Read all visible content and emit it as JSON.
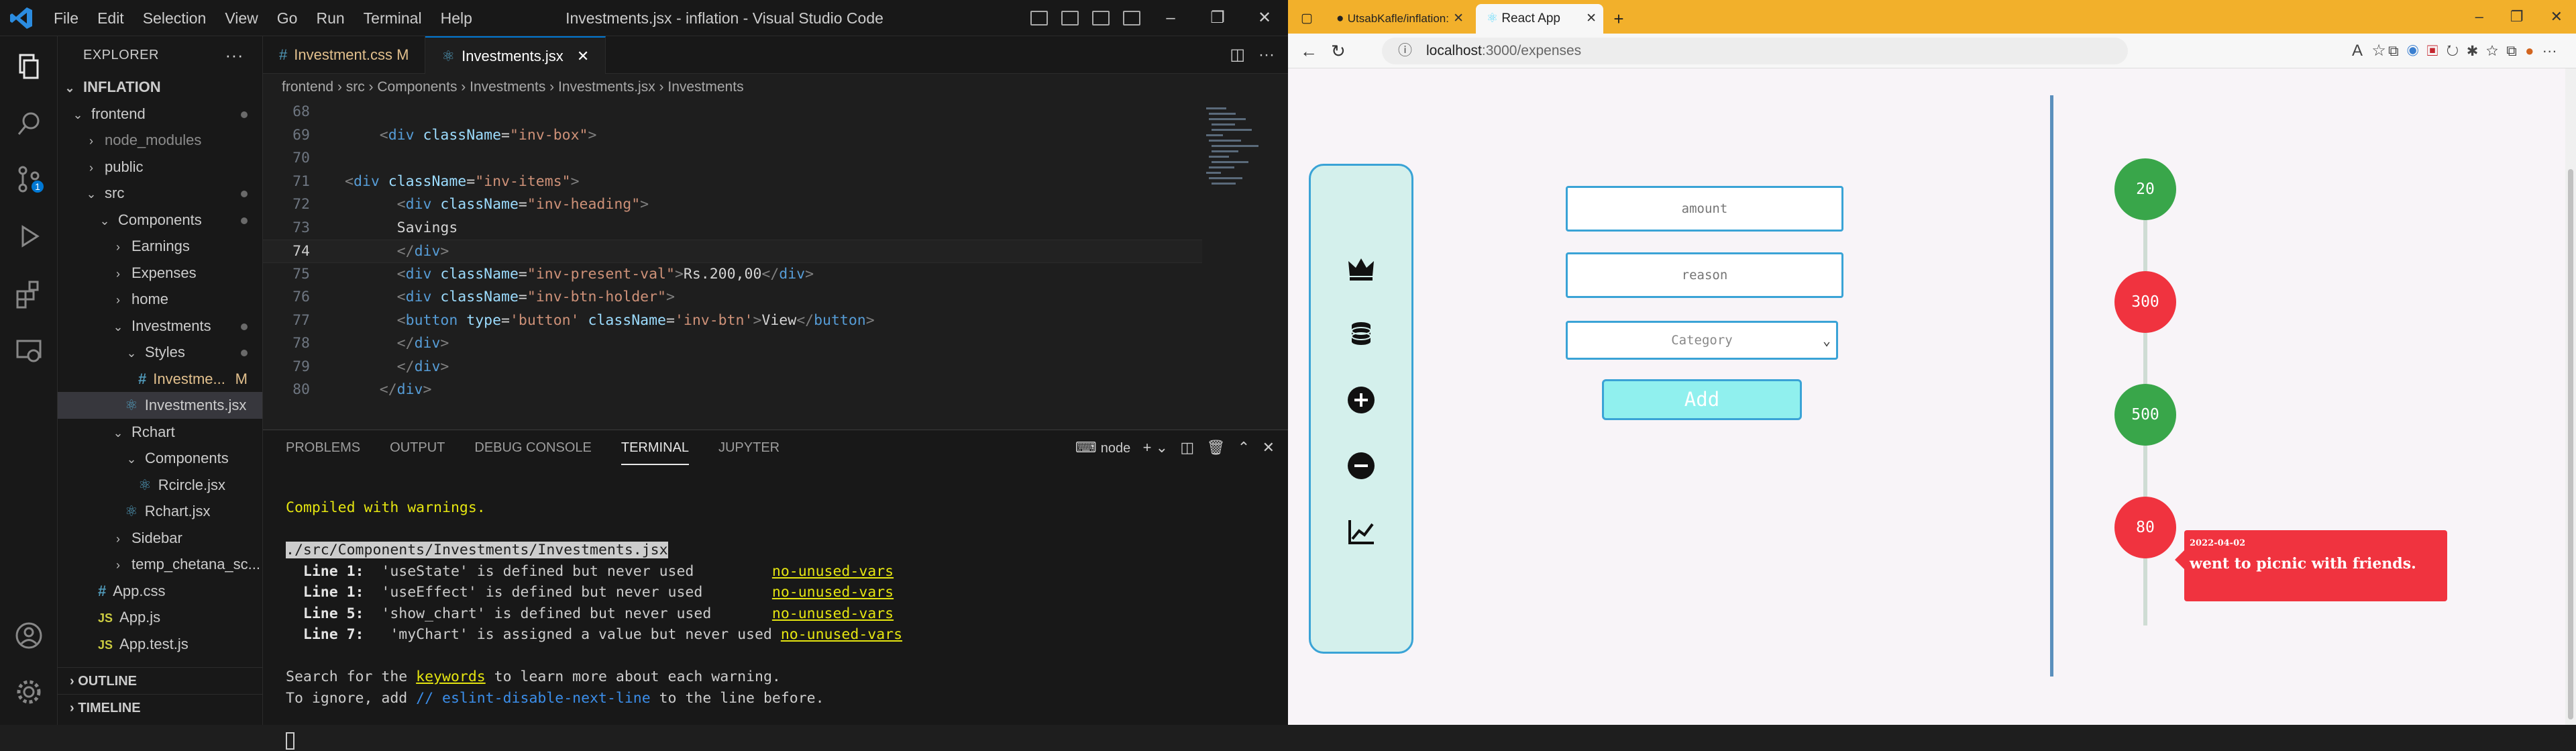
{
  "vscode": {
    "title": "Investments.jsx - inflation - Visual Studio Code",
    "menu": [
      "File",
      "Edit",
      "Selection",
      "View",
      "Go",
      "Run",
      "Terminal",
      "Help"
    ],
    "explorer_title": "EXPLORER",
    "workspace": "INFLATION",
    "tree": [
      {
        "label": "frontend",
        "indent": 1,
        "type": "folder-open",
        "dot": true
      },
      {
        "label": "node_modules",
        "indent": 2,
        "type": "folder",
        "dim": true
      },
      {
        "label": "public",
        "indent": 2,
        "type": "folder"
      },
      {
        "label": "src",
        "indent": 2,
        "type": "folder-open",
        "dot": true
      },
      {
        "label": "Components",
        "indent": 3,
        "type": "folder-open",
        "dot": true
      },
      {
        "label": "Earnings",
        "indent": 4,
        "type": "folder"
      },
      {
        "label": "Expenses",
        "indent": 4,
        "type": "folder"
      },
      {
        "label": "home",
        "indent": 4,
        "type": "folder"
      },
      {
        "label": "Investments",
        "indent": 4,
        "type": "folder-open",
        "dot": true
      },
      {
        "label": "Styles",
        "indent": 5,
        "type": "folder-open",
        "dot": true
      },
      {
        "label": "Investme...",
        "indent": 6,
        "type": "css",
        "mod": "M"
      },
      {
        "label": "Investments.jsx",
        "indent": 5,
        "type": "react",
        "selected": true
      },
      {
        "label": "Rchart",
        "indent": 4,
        "type": "folder-open"
      },
      {
        "label": "Components",
        "indent": 5,
        "type": "folder-open"
      },
      {
        "label": "Rcircle.jsx",
        "indent": 6,
        "type": "react"
      },
      {
        "label": "Rchart.jsx",
        "indent": 5,
        "type": "react"
      },
      {
        "label": "Sidebar",
        "indent": 4,
        "type": "folder"
      },
      {
        "label": "temp_chetana_sc...",
        "indent": 4,
        "type": "folder"
      },
      {
        "label": "App.css",
        "indent": 3,
        "type": "css"
      },
      {
        "label": "App.js",
        "indent": 3,
        "type": "js"
      },
      {
        "label": "App.test.js",
        "indent": 3,
        "type": "js"
      }
    ],
    "outline": "OUTLINE",
    "timeline": "TIMELINE",
    "tabs": [
      {
        "label": "Investment.css",
        "mod": "M",
        "icon": "#"
      },
      {
        "label": "Investments.jsx",
        "close": "✕",
        "icon": "react"
      }
    ],
    "breadcrumb": "frontend  ›  src  ›  Components  ›  Investments  ›  Investments.jsx  ›  Investments",
    "code_lines": [
      {
        "n": "68",
        "html": ""
      },
      {
        "n": "69",
        "html": "    <span class='t-pun'>&lt;</span><span class='t-tag'>div</span> <span class='t-attr'>className</span><span class='t-txt'>=</span><span class='t-str'>\"inv-box\"</span><span class='t-pun'>&gt;</span>"
      },
      {
        "n": "70",
        "html": ""
      },
      {
        "n": "71",
        "html": "<span class='t-pun'>&lt;</span><span class='t-tag'>div</span> <span class='t-attr'>className</span><span class='t-txt'>=</span><span class='t-str'>\"inv-items\"</span><span class='t-pun'>&gt;</span>"
      },
      {
        "n": "72",
        "html": "      <span class='t-pun'>&lt;</span><span class='t-tag'>div</span> <span class='t-attr'>className</span><span class='t-txt'>=</span><span class='t-str'>\"inv-heading\"</span><span class='t-pun'>&gt;</span>"
      },
      {
        "n": "73",
        "html": "      <span class='t-txt'>Savings</span>"
      },
      {
        "n": "74",
        "html": "      <span class='t-pun'>&lt;/</span><span class='t-tag'>div</span><span class='t-pun'>&gt;</span>",
        "cur": true
      },
      {
        "n": "75",
        "html": "      <span class='t-pun'>&lt;</span><span class='t-tag'>div</span> <span class='t-attr'>className</span><span class='t-txt'>=</span><span class='t-str'>\"inv-present-val\"</span><span class='t-pun'>&gt;</span><span class='t-txt'>Rs.200,00</span><span class='t-pun'>&lt;/</span><span class='t-tag'>div</span><span class='t-pun'>&gt;</span>"
      },
      {
        "n": "76",
        "html": "      <span class='t-pun'>&lt;</span><span class='t-tag'>div</span> <span class='t-attr'>className</span><span class='t-txt'>=</span><span class='t-str'>\"inv-btn-holder\"</span><span class='t-pun'>&gt;</span>"
      },
      {
        "n": "77",
        "html": "      <span class='t-pun'>&lt;</span><span class='t-tag'>button</span> <span class='t-attr'>type</span><span class='t-txt'>=</span><span class='t-str'>'button'</span> <span class='t-attr'>className</span><span class='t-txt'>=</span><span class='t-str'>'inv-btn'</span><span class='t-pun'>&gt;</span><span class='t-txt'>View</span><span class='t-pun'>&lt;/</span><span class='t-tag'>button</span><span class='t-pun'>&gt;</span>"
      },
      {
        "n": "78",
        "html": "      <span class='t-pun'>&lt;/</span><span class='t-tag'>div</span><span class='t-pun'>&gt;</span>"
      },
      {
        "n": "79",
        "html": "      <span class='t-pun'>&lt;/</span><span class='t-tag'>div</span><span class='t-pun'>&gt;</span>"
      },
      {
        "n": "80",
        "html": "    <span class='t-pun'>&lt;/</span><span class='t-tag'>div</span><span class='t-pun'>&gt;</span>"
      }
    ],
    "panel_tabs": [
      "PROBLEMS",
      "OUTPUT",
      "DEBUG CONSOLE",
      "TERMINAL",
      "JUPYTER"
    ],
    "panel_active": "TERMINAL",
    "terminal_shell": "node",
    "terminal": {
      "compiled": "Compiled with warnings.",
      "file": "./src/Components/Investments/Investments.jsx",
      "warnings": [
        {
          "line": "Line 1:",
          "msg": "  'useState' is defined but never used         ",
          "rule": "no-unused-vars"
        },
        {
          "line": "Line 1:",
          "msg": "  'useEffect' is defined but never used        ",
          "rule": "no-unused-vars"
        },
        {
          "line": "Line 5:",
          "msg": "  'show_chart' is defined but never used       ",
          "rule": "no-unused-vars"
        },
        {
          "line": "Line 7:",
          "msg": "   'myChart' is assigned a value but never used ",
          "rule": "no-unused-vars"
        }
      ],
      "search_pre": "Search for the ",
      "search_kw": "keywords",
      "search_post": " to learn more about each warning.",
      "ignore_pre": "To ignore, add ",
      "ignore_kw": "// eslint-disable-next-line",
      "ignore_post": " to the line before."
    }
  },
  "edge": {
    "tabs": [
      {
        "label": "UtsabKafle/inflation: Personal fi..."
      },
      {
        "label": "React App",
        "active": true
      }
    ],
    "url_host": "localhost",
    "url_path": ":3000/expenses",
    "form": {
      "amount_placeholder": "amount",
      "reason_placeholder": "reason",
      "category": "Category",
      "add_label": "Add"
    },
    "timeline": [
      {
        "value": "20",
        "color": "green"
      },
      {
        "value": "300",
        "color": "red"
      },
      {
        "value": "500",
        "color": "green"
      },
      {
        "value": "80",
        "color": "red"
      }
    ],
    "tooltip": {
      "date": "2022-04-02",
      "text": "went to picnic with friends."
    }
  }
}
